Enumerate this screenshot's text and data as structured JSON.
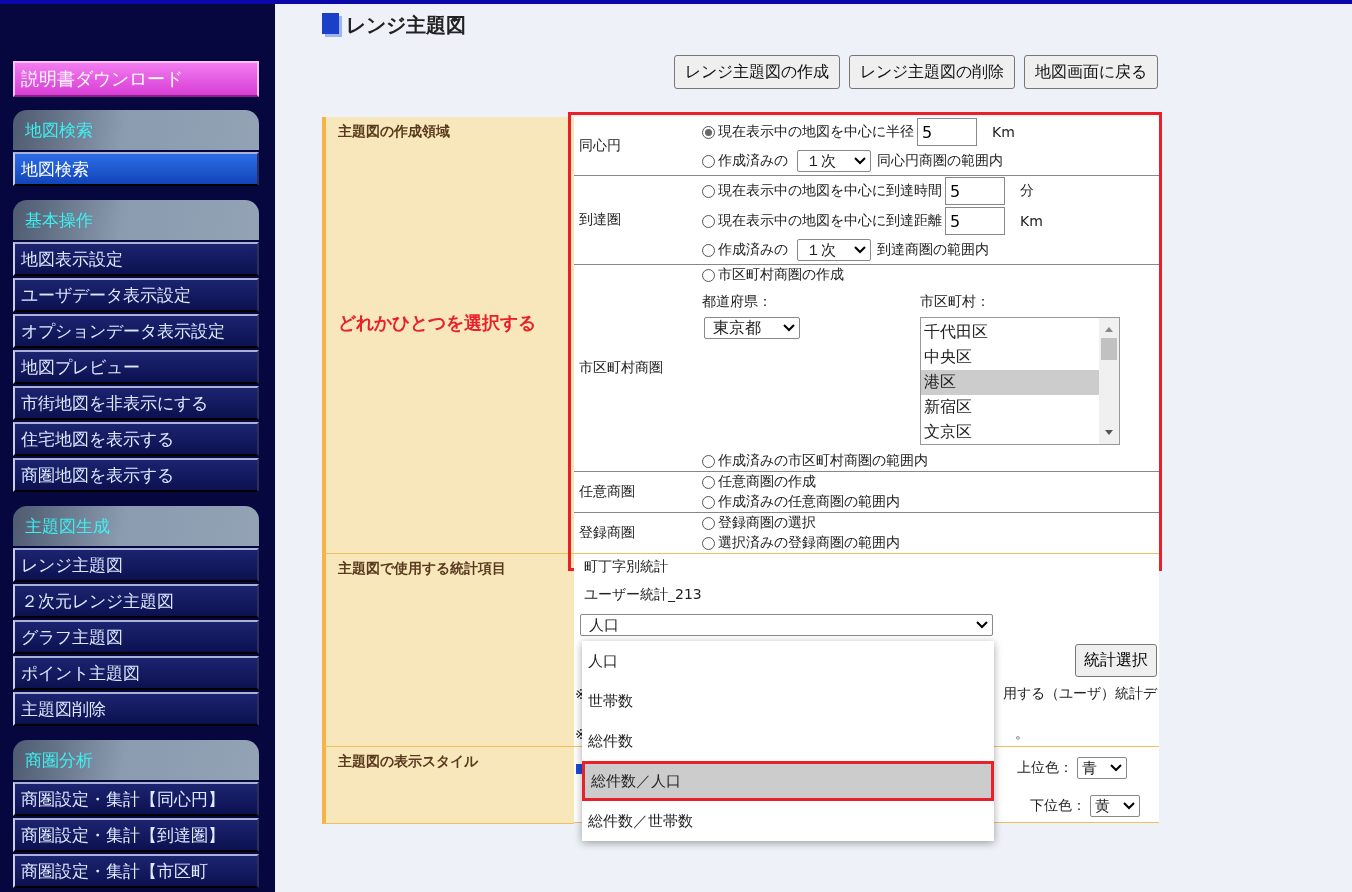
{
  "sidebar": {
    "download_button": "説明書ダウンロード",
    "sections": [
      {
        "title": "地図検索",
        "items": [
          {
            "label": "地図検索",
            "selected": true
          }
        ]
      },
      {
        "title": "基本操作",
        "items": [
          {
            "label": "地図表示設定",
            "selected": false
          },
          {
            "label": "ユーザデータ表示設定",
            "selected": false
          },
          {
            "label": "オプションデータ表示設定",
            "selected": false
          },
          {
            "label": "地図プレビュー",
            "selected": false
          },
          {
            "label": "市街地図を非表示にする",
            "selected": false
          },
          {
            "label": "住宅地図を表示する",
            "selected": false
          },
          {
            "label": "商圏地図を表示する",
            "selected": false
          }
        ]
      },
      {
        "title": "主題図生成",
        "items": [
          {
            "label": "レンジ主題図",
            "selected": false
          },
          {
            "label": "２次元レンジ主題図",
            "selected": false
          },
          {
            "label": "グラフ主題図",
            "selected": false
          },
          {
            "label": "ポイント主題図",
            "selected": false
          },
          {
            "label": "主題図削除",
            "selected": false
          }
        ]
      },
      {
        "title": "商圏分析",
        "items": [
          {
            "label": "商圏設定・集計【同心円】",
            "selected": false
          },
          {
            "label": "商圏設定・集計【到達圏】",
            "selected": false
          },
          {
            "label": "商圏設定・集計【市区町",
            "selected": false
          }
        ]
      }
    ]
  },
  "page": {
    "title": "レンジ主題図",
    "buttons": [
      "レンジ主題図の作成",
      "レンジ主題図の削除",
      "地図画面に戻る"
    ]
  },
  "area": {
    "label": "主題図の作成領域",
    "annotation": "どれかひとつを選択する",
    "highlighted": true,
    "groups": [
      {
        "label": "同心円",
        "rows": [
          {
            "kind": "input",
            "selected": true,
            "text": "現在表示中の地図を中心に半径",
            "value": "5",
            "unit": "Km"
          },
          {
            "kind": "select",
            "selected": false,
            "text": "作成済みの",
            "select": "１次",
            "suffix": "同心円商圏の範囲内"
          }
        ]
      },
      {
        "label": "到達圏",
        "rows": [
          {
            "kind": "input",
            "selected": false,
            "text": "現在表示中の地図を中心に到達時間",
            "value": "5",
            "unit": "分"
          },
          {
            "kind": "input",
            "selected": false,
            "text": "現在表示中の地図を中心に到達距離",
            "value": "5",
            "unit": "Km"
          },
          {
            "kind": "select",
            "selected": false,
            "text": "作成済みの",
            "select": "１次",
            "suffix": "到達商圏の範囲内"
          }
        ]
      },
      {
        "label": "市区町村商圏",
        "rows": [
          {
            "kind": "radio",
            "selected": false,
            "text": "市区町村商圏の作成"
          },
          {
            "kind": "picker",
            "pref_label": "都道府県：",
            "pref": "東京都",
            "city_label": "市区町村：",
            "cities": [
              {
                "name": "千代田区",
                "selected": false
              },
              {
                "name": "中央区",
                "selected": false
              },
              {
                "name": "港区",
                "selected": true
              },
              {
                "name": "新宿区",
                "selected": false
              },
              {
                "name": "文京区",
                "selected": false
              }
            ]
          },
          {
            "kind": "radio",
            "selected": false,
            "text": "作成済みの市区町村商圏の範囲内"
          }
        ]
      },
      {
        "label": "任意商圏",
        "rows": [
          {
            "kind": "radio",
            "selected": false,
            "text": "任意商圏の作成"
          },
          {
            "kind": "radio",
            "selected": false,
            "text": "作成済みの任意商圏の範囲内"
          }
        ]
      },
      {
        "label": "登録商圏",
        "rows": [
          {
            "kind": "radio",
            "selected": false,
            "text": "登録商圏の選択"
          },
          {
            "kind": "radio",
            "selected": false,
            "text": "選択済みの登録商圏の範囲内"
          }
        ]
      }
    ]
  },
  "stats": {
    "label": "主題図で使用する統計項目",
    "source": "町丁字別統計",
    "dataset": "ユーザー統計_213",
    "select": "人口",
    "button": "統計選択",
    "options": [
      {
        "label": "人口",
        "selected": false,
        "highlighted": false
      },
      {
        "label": "世帯数",
        "selected": false,
        "highlighted": false
      },
      {
        "label": "総件数",
        "selected": false,
        "highlighted": false
      },
      {
        "label": "総件数／人口",
        "selected": true,
        "highlighted": true
      },
      {
        "label": "総件数／世帯数",
        "selected": false,
        "highlighted": false
      }
    ],
    "notes": [
      {
        "mark": "※",
        "tail": "用する（ユーザ）統計デ"
      },
      {
        "mark": "※",
        "tail": "。"
      }
    ]
  },
  "style": {
    "label": "主題図の表示スタイル",
    "upper_label": "上位色：",
    "upper": "青",
    "lower_label": "下位色：",
    "lower": "黄"
  }
}
